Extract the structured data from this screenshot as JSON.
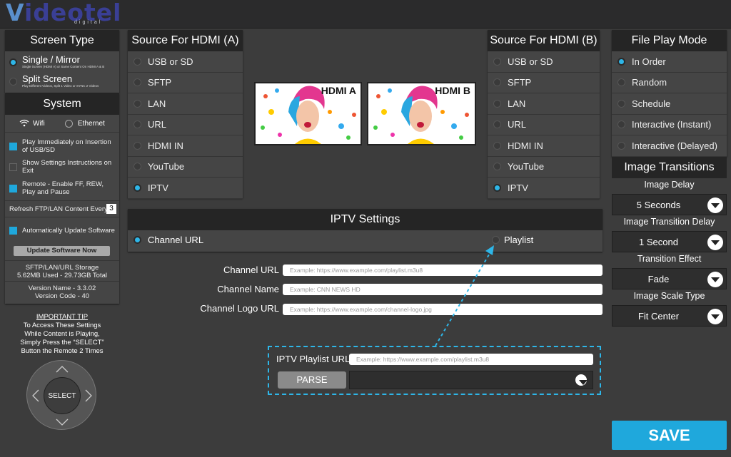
{
  "header": {
    "logo_text": "ideotel",
    "logo_v": "V",
    "logo_sub": "digital"
  },
  "screen_type": {
    "title": "Screen Type",
    "options": [
      {
        "label": "Single / Mirror",
        "desc": "Single Screen (HDMI A) or Same Content On HDMI A & B",
        "selected": true
      },
      {
        "label": "Split Screen",
        "desc": "Play Different Videos, Split 1 Video or SYNC 2 Videos",
        "selected": false
      }
    ]
  },
  "system": {
    "title": "System",
    "wifi": "Wifi",
    "ethernet": "Ethernet",
    "checks": [
      {
        "label": "Play Immediately on Insertion of USB/SD",
        "checked": true
      },
      {
        "label": "Show Settings Instructions on Exit",
        "checked": false
      },
      {
        "label": "Remote - Enable FF, REW, Play and Pause",
        "checked": true
      }
    ],
    "refresh_label": "Refresh FTP/LAN Content Every:",
    "refresh_value": "3",
    "auto_update": "Automatically Update Software",
    "update_button": "Update Software Now",
    "storage_title": "SFTP/LAN/URL Storage",
    "storage_value": "5.62MB Used - 29.73GB Total",
    "version_name": "Version Name - 3.3.02",
    "version_code": "Version Code - 40"
  },
  "tip": {
    "title": "IMPORTANT TIP",
    "line1": "To Access These Settings",
    "line2": "While Content is Playing,",
    "line3": "Simply Press the “SELECT”",
    "line4": "Button the Remote 2 Times"
  },
  "remote": {
    "select": "SELECT"
  },
  "hdmi_a": {
    "title": "Source For HDMI (A)",
    "options": [
      "USB or SD",
      "SFTP",
      "LAN",
      "URL",
      "HDMI IN",
      "YouTube",
      "IPTV"
    ],
    "selected": 6
  },
  "hdmi_b": {
    "title": "Source For HDMI (B)",
    "options": [
      "USB or SD",
      "SFTP",
      "LAN",
      "URL",
      "HDMI IN",
      "YouTube",
      "IPTV"
    ],
    "selected": 6
  },
  "previews": {
    "a": "HDMI A",
    "b": "HDMI B"
  },
  "file_play": {
    "title": "File Play Mode",
    "options": [
      "In Order",
      "Random",
      "Schedule",
      "Interactive  (Instant)",
      "Interactive (Delayed)"
    ],
    "selected": 0
  },
  "transitions": {
    "title": "Image Transitions",
    "image_delay_label": "Image Delay",
    "image_delay": "5 Seconds",
    "transition_delay_label": "Image Transition Delay",
    "transition_delay": "1 Second",
    "effect_label": "Transition Effect",
    "effect": "Fade",
    "scale_label": "Image Scale Type",
    "scale": "Fit Center"
  },
  "iptv": {
    "title": "IPTV Settings",
    "channel_url_option": "Channel URL",
    "playlist_option": "Playlist",
    "channel_url_label": "Channel URL",
    "channel_url_placeholder": "Example: https://www.example.com/playlist.m3u8",
    "channel_name_label": "Channel Name",
    "channel_name_placeholder": "Example: CNN NEWS HD",
    "channel_logo_label": "Channel Logo URL",
    "channel_logo_placeholder": "Example: https://www.example.com/channel-logo.jpg",
    "playlist_url_label": "IPTV Playlist URL",
    "playlist_url_placeholder": "Example: https://www.example.com/playlist.m3u8",
    "parse_button": "PARSE"
  },
  "save_button": "SAVE",
  "colors": {
    "accent": "#2eb6e8",
    "save": "#1fa8dc",
    "panel": "#454545",
    "header": "#252525"
  }
}
